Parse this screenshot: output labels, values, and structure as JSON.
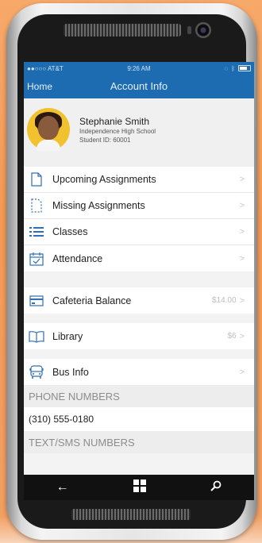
{
  "status": {
    "carrier": "●●○○○ AT&T",
    "time": "9:26 AM",
    "icons": [
      "wifi-icon",
      "location-icon",
      "bluetooth-icon",
      "battery-icon"
    ]
  },
  "nav": {
    "back_label": "Home",
    "title": "Account Info"
  },
  "profile": {
    "name": "Stephanie Smith",
    "school": "Independence High School",
    "student_id": "Student ID: 60001"
  },
  "menu_group_1": [
    {
      "label": "Upcoming Assignments",
      "icon": "document-icon"
    },
    {
      "label": "Missing Assignments",
      "icon": "missing-document-icon"
    },
    {
      "label": "Classes",
      "icon": "list-icon"
    },
    {
      "label": "Attendance",
      "icon": "calendar-check-icon"
    }
  ],
  "cafeteria": {
    "label": "Cafeteria Balance",
    "value": "$14.00",
    "icon": "card-icon"
  },
  "library": {
    "label": "Library",
    "value": "$6",
    "icon": "book-icon"
  },
  "bus": {
    "label": "Bus Info",
    "icon": "bus-icon"
  },
  "sections": {
    "phone_header": "PHONE NUMBERS",
    "phone_number": "(310) 555-0180",
    "sms_header": "TEXT/SMS NUMBERS"
  },
  "colors": {
    "accent": "#1d6bb0",
    "icon_blue": "#2e6fb5",
    "background": "#f49a55"
  }
}
